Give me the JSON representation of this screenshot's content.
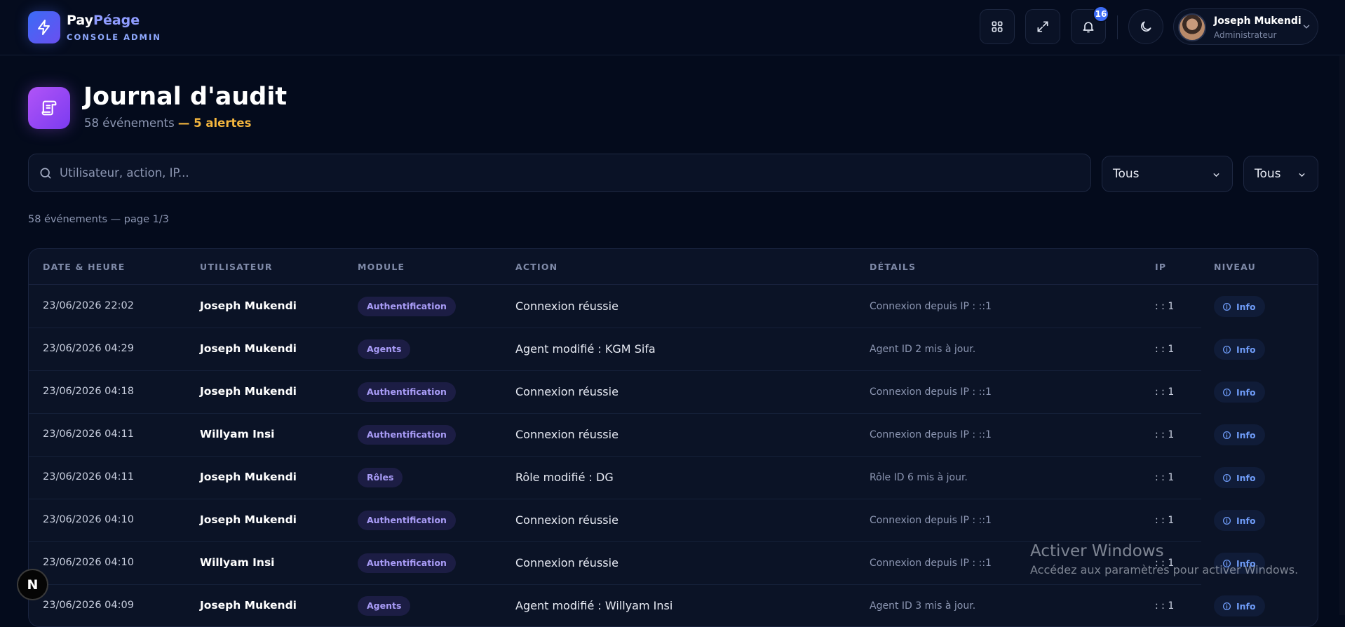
{
  "brand": {
    "name_part1": "Pay",
    "name_part2": "Péage",
    "subtitle": "CONSOLE ADMIN"
  },
  "topbar": {
    "notifications_count": "16",
    "user": {
      "name": "Joseph Mukendi",
      "role": "Administrateur"
    }
  },
  "page": {
    "title": "Journal d'audit",
    "events_text": "58 événements",
    "alerts_text": "— 5 alertes"
  },
  "filters": {
    "search_placeholder": "Utilisateur, action, IP...",
    "select1": "Tous",
    "select2": "Tous"
  },
  "count_text": "58 événements — page 1/3",
  "table": {
    "headers": [
      "DATE & HEURE",
      "UTILISATEUR",
      "MODULE",
      "ACTION",
      "DÉTAILS",
      "IP",
      "NIVEAU"
    ],
    "rows": [
      {
        "date": "23/06/2026 22:02",
        "user": "Joseph Mukendi",
        "module": "Authentification",
        "action": "Connexion réussie",
        "details": "Connexion depuis IP : ::1",
        "ip": ": : 1",
        "level": "Info"
      },
      {
        "date": "23/06/2026 04:29",
        "user": "Joseph Mukendi",
        "module": "Agents",
        "action": "Agent modifié : KGM Sifa",
        "details": "Agent ID 2 mis à jour.",
        "ip": ": : 1",
        "level": "Info"
      },
      {
        "date": "23/06/2026 04:18",
        "user": "Joseph Mukendi",
        "module": "Authentification",
        "action": "Connexion réussie",
        "details": "Connexion depuis IP : ::1",
        "ip": ": : 1",
        "level": "Info"
      },
      {
        "date": "23/06/2026 04:11",
        "user": "Willyam Insi",
        "module": "Authentification",
        "action": "Connexion réussie",
        "details": "Connexion depuis IP : ::1",
        "ip": ": : 1",
        "level": "Info"
      },
      {
        "date": "23/06/2026 04:11",
        "user": "Joseph Mukendi",
        "module": "Rôles",
        "action": "Rôle modifié : DG",
        "details": "Rôle ID 6 mis à jour.",
        "ip": ": : 1",
        "level": "Info"
      },
      {
        "date": "23/06/2026 04:10",
        "user": "Joseph Mukendi",
        "module": "Authentification",
        "action": "Connexion réussie",
        "details": "Connexion depuis IP : ::1",
        "ip": ": : 1",
        "level": "Info"
      },
      {
        "date": "23/06/2026 04:10",
        "user": "Willyam Insi",
        "module": "Authentification",
        "action": "Connexion réussie",
        "details": "Connexion depuis IP : ::1",
        "ip": ": : 1",
        "level": "Info"
      },
      {
        "date": "23/06/2026 04:09",
        "user": "Joseph Mukendi",
        "module": "Agents",
        "action": "Agent modifié : Willyam Insi",
        "details": "Agent ID 3 mis à jour.",
        "ip": ": : 1",
        "level": "Info"
      }
    ]
  },
  "dev_badge": "N",
  "watermark": {
    "title": "Activer Windows",
    "text": "Accédez aux paramètres pour activer Windows."
  },
  "colors": {
    "background": "#040b1c",
    "accent_blue": "#3d6cf5",
    "accent_purple": "#a855f7",
    "alert_orange": "#f4b63e",
    "info_blue": "#6f9cf8"
  },
  "icons": [
    "bolt-icon",
    "grid-icon",
    "expand-icon",
    "bell-icon",
    "moon-icon",
    "chevron-down-icon",
    "scroll-icon",
    "search-icon",
    "info-circle-icon"
  ]
}
